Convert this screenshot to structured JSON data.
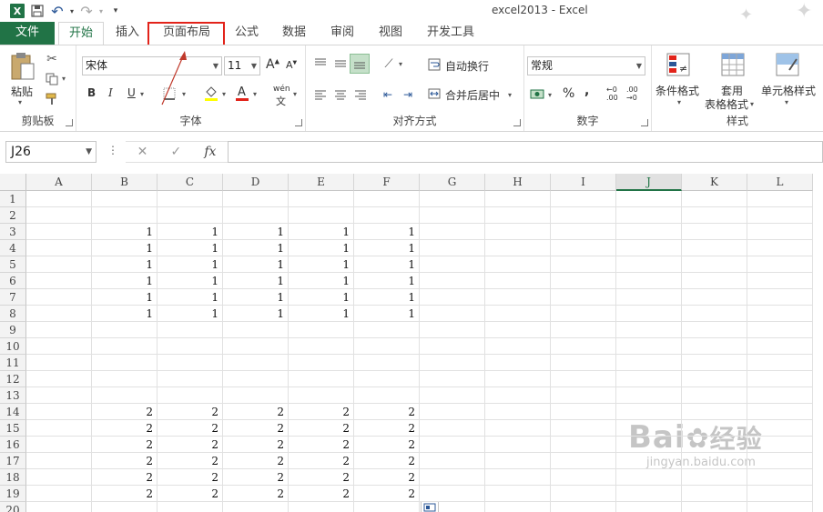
{
  "window": {
    "title": "excel2013 - Excel"
  },
  "qat": {
    "undo": "↶",
    "redo": "↷",
    "more": "▾"
  },
  "tabs": [
    "文件",
    "开始",
    "插入",
    "页面布局",
    "公式",
    "数据",
    "审阅",
    "视图",
    "开发工具"
  ],
  "ribbon": {
    "clipboard": {
      "paste": "粘贴",
      "label": "剪贴板"
    },
    "font": {
      "name": "宋体",
      "size": "11",
      "grow": "A",
      "shrink": "A",
      "bold": "B",
      "italic": "I",
      "underline": "U",
      "phonetic": "wén",
      "label": "字体"
    },
    "alignment": {
      "wrap": "自动换行",
      "merge": "合并后居中",
      "label": "对齐方式"
    },
    "number": {
      "format": "常规",
      "percent": "%",
      "comma": ",",
      "label": "数字"
    },
    "styles": {
      "conditional": "条件格式",
      "table1": "套用",
      "table2": "表格格式",
      "cell": "单元格样式",
      "label": "样式"
    }
  },
  "formula_bar": {
    "name_box": "J26",
    "cancel": "✕",
    "enter": "✓",
    "fx": "fx",
    "value": ""
  },
  "grid": {
    "columns": [
      "A",
      "B",
      "C",
      "D",
      "E",
      "F",
      "G",
      "H",
      "I",
      "J",
      "K",
      "L"
    ],
    "selected_column": "J",
    "rows": [
      {
        "n": "1",
        "values": [
          "",
          "",
          "",
          "",
          "",
          ""
        ]
      },
      {
        "n": "2",
        "values": [
          "",
          "",
          "",
          "",
          "",
          ""
        ]
      },
      {
        "n": "3",
        "values": [
          "",
          "1",
          "1",
          "1",
          "1",
          "1"
        ]
      },
      {
        "n": "4",
        "values": [
          "",
          "1",
          "1",
          "1",
          "1",
          "1"
        ]
      },
      {
        "n": "5",
        "values": [
          "",
          "1",
          "1",
          "1",
          "1",
          "1"
        ]
      },
      {
        "n": "6",
        "values": [
          "",
          "1",
          "1",
          "1",
          "1",
          "1"
        ]
      },
      {
        "n": "7",
        "values": [
          "",
          "1",
          "1",
          "1",
          "1",
          "1"
        ]
      },
      {
        "n": "8",
        "values": [
          "",
          "1",
          "1",
          "1",
          "1",
          "1"
        ]
      },
      {
        "n": "9",
        "values": [
          "",
          "",
          "",
          "",
          "",
          ""
        ]
      },
      {
        "n": "10",
        "values": [
          "",
          "",
          "",
          "",
          "",
          ""
        ]
      },
      {
        "n": "11",
        "values": [
          "",
          "",
          "",
          "",
          "",
          ""
        ]
      },
      {
        "n": "12",
        "values": [
          "",
          "",
          "",
          "",
          "",
          ""
        ]
      },
      {
        "n": "13",
        "values": [
          "",
          "",
          "",
          "",
          "",
          ""
        ]
      },
      {
        "n": "14",
        "values": [
          "",
          "2",
          "2",
          "2",
          "2",
          "2"
        ]
      },
      {
        "n": "15",
        "values": [
          "",
          "2",
          "2",
          "2",
          "2",
          "2"
        ]
      },
      {
        "n": "16",
        "values": [
          "",
          "2",
          "2",
          "2",
          "2",
          "2"
        ]
      },
      {
        "n": "17",
        "values": [
          "",
          "2",
          "2",
          "2",
          "2",
          "2"
        ]
      },
      {
        "n": "18",
        "values": [
          "",
          "2",
          "2",
          "2",
          "2",
          "2"
        ]
      },
      {
        "n": "19",
        "values": [
          "",
          "2",
          "2",
          "2",
          "2",
          "2"
        ]
      },
      {
        "n": "20",
        "values": [
          "",
          "",
          "",
          "",
          "",
          ""
        ]
      }
    ]
  },
  "watermark": {
    "brand": "Bai",
    "brand2": "经验",
    "url": "jingyan.baidu.com"
  },
  "colors": {
    "accent": "#217346",
    "highlight": "#e2231a"
  }
}
